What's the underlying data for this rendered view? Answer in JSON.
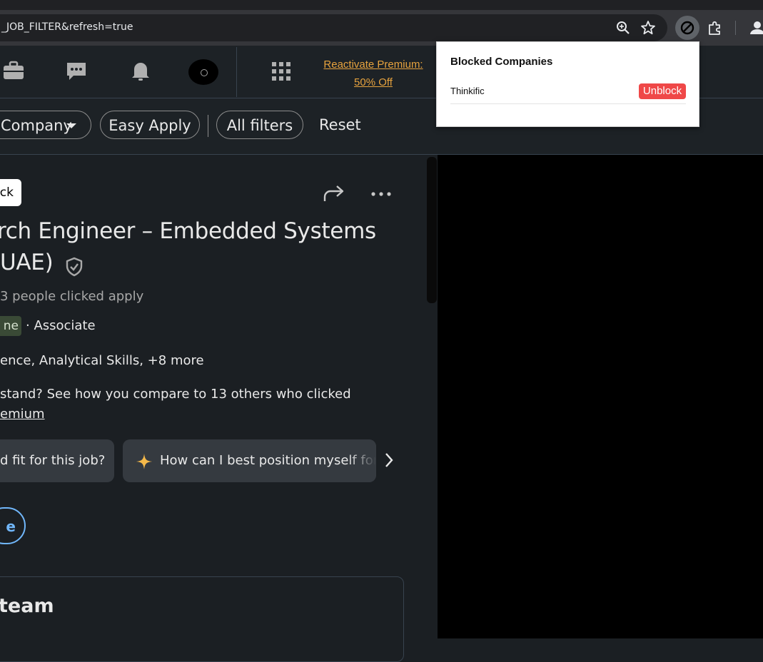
{
  "browser": {
    "url": "_JOB_FILTER&refresh=true",
    "icons": [
      "zoom-icon",
      "star-icon",
      "block-extension-icon",
      "puzzle-icon",
      "profile-icon"
    ]
  },
  "nav": {
    "icons": [
      "jobs-icon",
      "messaging-icon",
      "notifications-icon",
      "avatar",
      "grid-icon"
    ],
    "premium_line1": "Reactivate Premium:",
    "premium_line2": "50% Off",
    "premium_color": "#e7a33e"
  },
  "filters": {
    "company": "Company",
    "easy_apply": "Easy Apply",
    "all_filters": "All filters",
    "reset": "Reset"
  },
  "job": {
    "back_label": "ck",
    "title_line1": "rch Engineer – Embedded Systems",
    "title_line2": "UAE)",
    "applicants": "3 people clicked apply",
    "workplace_badge": "ne",
    "level": "· Associate",
    "skills": "ence, Analytical Skills, +8 more",
    "compare": "stand? See how you compare to 13 others who clicked",
    "premium_try": "emium",
    "chips": [
      "d fit for this job?",
      "How can I best position myself for t"
    ],
    "save_label": "e",
    "team_title": "team"
  },
  "popup": {
    "title": "Blocked Companies",
    "blocked": [
      {
        "name": "Thinkific",
        "action": "Unblock"
      }
    ],
    "unblock_color": "#ef4848"
  }
}
